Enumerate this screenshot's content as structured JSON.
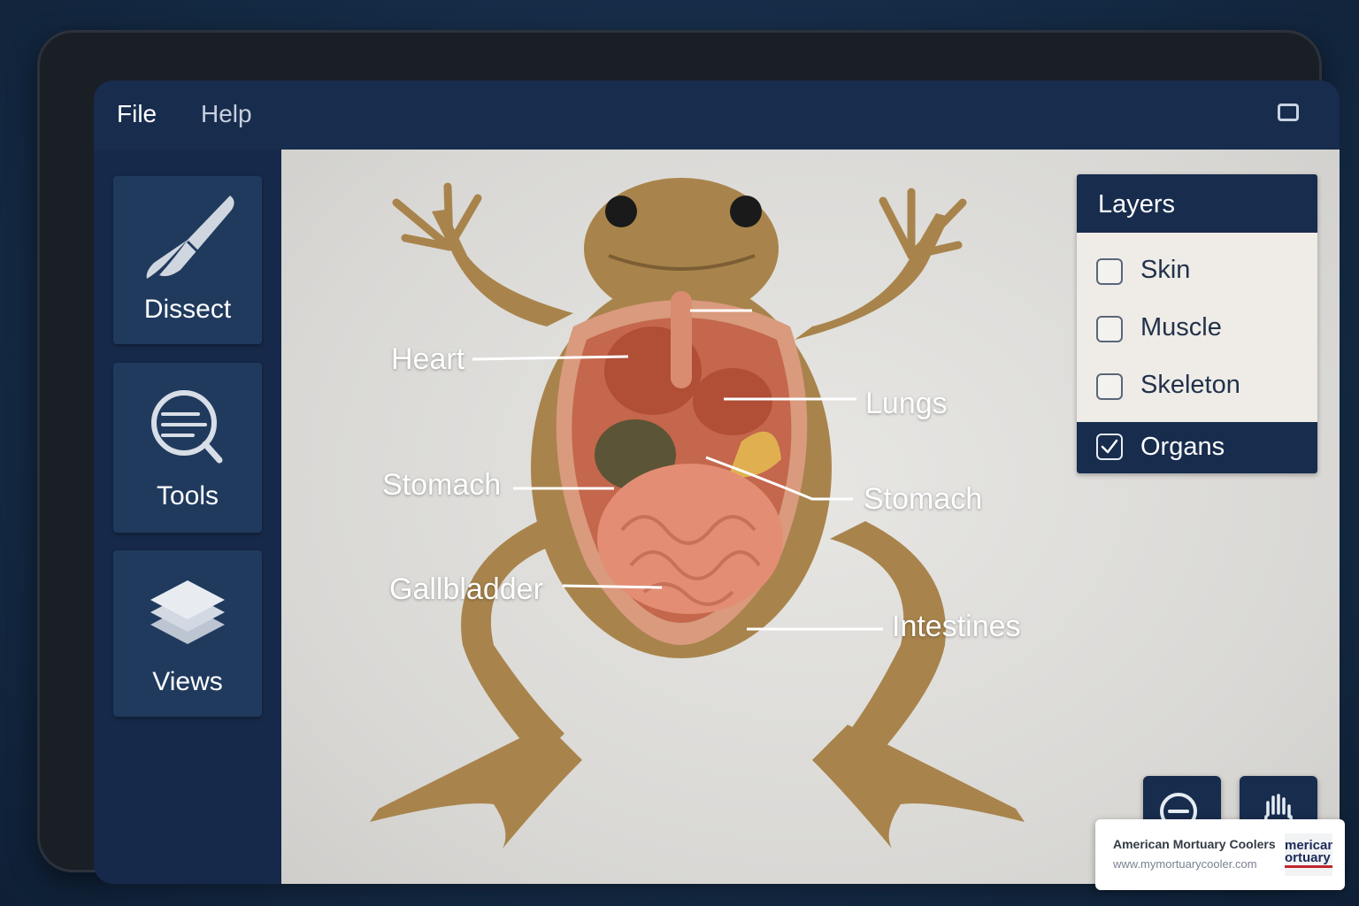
{
  "menubar": {
    "file": "File",
    "help": "Help"
  },
  "sidebar": {
    "items": [
      {
        "label": "Dissect",
        "icon": "scalpel-icon"
      },
      {
        "label": "Tools",
        "icon": "magnifier-icon"
      },
      {
        "label": "Views",
        "icon": "layers-stack-icon"
      }
    ]
  },
  "canvas": {
    "callouts": [
      {
        "label": "Heart"
      },
      {
        "label": "Lungs"
      },
      {
        "label": "Stomach"
      },
      {
        "label": "Stomach"
      },
      {
        "label": "Gallbladder"
      },
      {
        "label": "Intestines"
      }
    ]
  },
  "layers": {
    "title": "Layers",
    "items": [
      {
        "label": "Skin",
        "checked": false
      },
      {
        "label": "Muscle",
        "checked": false
      },
      {
        "label": "Skeleton",
        "checked": false
      },
      {
        "label": "Organs",
        "checked": true
      }
    ]
  },
  "controls": {
    "zoom_icon": "zoom-out-icon",
    "pan_icon": "hand-icon"
  },
  "watermark": {
    "name": "American Mortuary Coolers",
    "url": "www.mymortuarycooler.com",
    "logo_line1": "merican",
    "logo_line2": "ortuary"
  },
  "colors": {
    "accent": "#182c4d",
    "panel": "#203a5e",
    "canvas": "#dcdbd8"
  }
}
